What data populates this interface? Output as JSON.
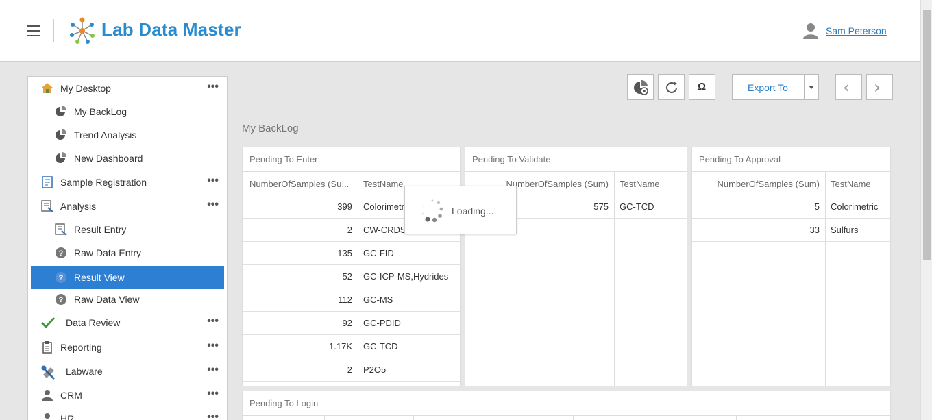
{
  "app": {
    "title": "Lab Data Master"
  },
  "user": {
    "name": "Sam Peterson"
  },
  "sidebar": {
    "items": [
      {
        "label": "My Desktop",
        "icon": "home-icon",
        "more": "•••"
      },
      {
        "label": "My BackLog",
        "icon": "chart-pie-icon"
      },
      {
        "label": "Trend Analysis",
        "icon": "chart-pie-icon"
      },
      {
        "label": "New Dashboard",
        "icon": "chart-pie-icon"
      },
      {
        "label": "Sample Registration",
        "icon": "registration-icon",
        "more": "•••"
      },
      {
        "label": "Analysis",
        "icon": "analysis-icon",
        "more": "•••"
      },
      {
        "label": "Result Entry",
        "icon": "result-entry-icon"
      },
      {
        "label": "Raw Data Entry",
        "icon": "question-icon"
      },
      {
        "label": "Result View",
        "icon": "question-icon",
        "active": true
      },
      {
        "label": "Raw Data View",
        "icon": "question-icon"
      },
      {
        "label": "Data Review",
        "icon": "check-icon",
        "more": "•••"
      },
      {
        "label": "Reporting",
        "icon": "clipboard-icon",
        "more": "•••"
      },
      {
        "label": "Labware",
        "icon": "tools-icon",
        "more": "•••"
      },
      {
        "label": "CRM",
        "icon": "person-icon",
        "more": "•••"
      },
      {
        "label": "HR",
        "icon": "person-icon",
        "more": "•••"
      }
    ]
  },
  "toolbar": {
    "export_label": "Export To",
    "omega_label": "Ω",
    "prev_label": "‹",
    "next_label": "›"
  },
  "main": {
    "section_title": "My BackLog",
    "loading_text": "Loading...",
    "panels": [
      {
        "title": "Pending To Enter",
        "col1": "NumberOfSamples (Su...",
        "col2": "TestName",
        "rows": [
          {
            "n": "399",
            "t": "Colorimetric"
          },
          {
            "n": "2",
            "t": "CW-CRDS"
          },
          {
            "n": "135",
            "t": "GC-FID"
          },
          {
            "n": "52",
            "t": "GC-ICP-MS,Hydrides"
          },
          {
            "n": "112",
            "t": "GC-MS"
          },
          {
            "n": "92",
            "t": "GC-PDID"
          },
          {
            "n": "1.17K",
            "t": "GC-TCD"
          },
          {
            "n": "2",
            "t": "P2O5"
          }
        ]
      },
      {
        "title": "Pending To Validate",
        "col1": "NumberOfSamples (Sum)",
        "col2": "TestName",
        "rows": [
          {
            "n": "575",
            "t": "GC-TCD"
          }
        ]
      },
      {
        "title": "Pending To Approval",
        "col1": "NumberOfSamples (Sum)",
        "col2": "TestName",
        "rows": [
          {
            "n": "5",
            "t": "Colorimetric"
          },
          {
            "n": "33",
            "t": "Sulfurs"
          }
        ]
      }
    ],
    "bottom_panel_title": "Pending To Login"
  },
  "colors": {
    "accent": "#2d7fd3",
    "brand": "#2a8ccf",
    "link": "#2a7fc4"
  }
}
